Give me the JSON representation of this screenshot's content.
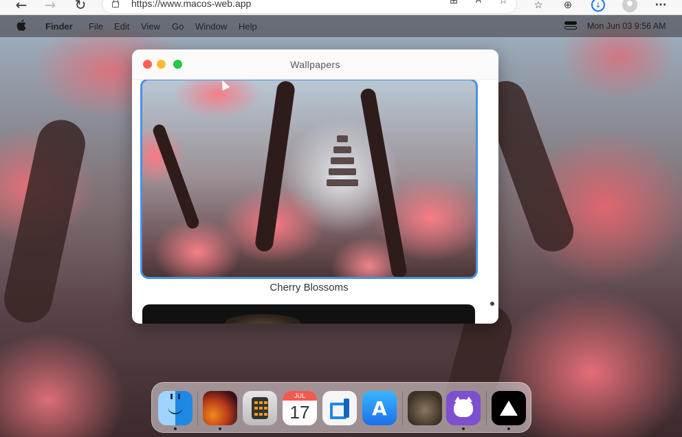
{
  "browser": {
    "back_glyph": "←",
    "forward_glyph": "→",
    "reload_glyph": "↻",
    "url": "https://www.macos-web.app",
    "icons": [
      "grid-icon",
      "read-aloud-icon",
      "favorites-add-icon",
      "favorites-icon",
      "collections-icon",
      "download-icon",
      "profile-icon",
      "more-icon"
    ],
    "more_glyph": "···"
  },
  "menubar": {
    "app_name": "Finder",
    "items": [
      "File",
      "Edit",
      "View",
      "Go",
      "Window",
      "Help"
    ],
    "clock": "Mon Jun 03  9:56 AM"
  },
  "window": {
    "title": "Wallpapers",
    "selected_caption": "Cherry Blossoms",
    "accent": "#4a90e2"
  },
  "dock": {
    "apps": [
      {
        "name": "Finder",
        "running": true
      },
      {
        "name": "Wallpapers",
        "running": true
      },
      {
        "name": "Calculator",
        "running": false
      },
      {
        "name": "Calendar",
        "running": false,
        "month": "JUL",
        "day": "17"
      },
      {
        "name": "VS Code",
        "running": false
      },
      {
        "name": "App Store",
        "running": false,
        "glyph": "A"
      },
      {
        "name": "Purrfect Code",
        "running": false
      },
      {
        "name": "GitHub",
        "running": true
      },
      {
        "name": "Vercel",
        "running": true
      }
    ]
  },
  "colors": {
    "traffic_red": "#ff5f57",
    "traffic_yellow": "#febc2e",
    "traffic_green": "#28c840",
    "calendar_red": "#f25a4f"
  }
}
